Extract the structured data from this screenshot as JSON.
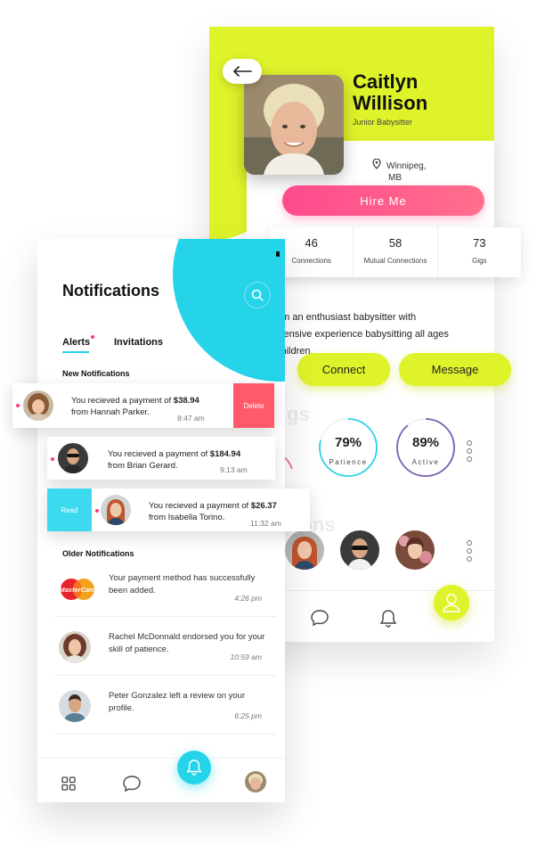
{
  "profile": {
    "back_label": "←",
    "first_name": "Caitlyn",
    "last_name": "Willison",
    "role": "Junior Babysitter",
    "location_line1": "Winnipeg,",
    "location_line2": "MB",
    "hire_label": "Hire Me",
    "stats": [
      {
        "value": "46",
        "label": "Connections"
      },
      {
        "value": "58",
        "label": "Mutual Connections"
      },
      {
        "value": "73",
        "label": "Gigs"
      }
    ],
    "about_title": "o",
    "about_lines": [
      "am an enthusiast babysitter with",
      "xtensive experience babysitting all ages",
      "children."
    ],
    "connect_label": "Connect",
    "message_label": "Message",
    "faded_skills": "gs",
    "faded_connections": "tions",
    "rings": [
      {
        "value": "79%",
        "label": "Patience",
        "fraction": 0.79,
        "color": "#2bd3e8"
      },
      {
        "value": "89%",
        "label": "Active",
        "fraction": 0.89,
        "color": "#7a5fb0"
      }
    ],
    "partial_ring_color": "#ff5a6a",
    "accent_color": "#dff32a"
  },
  "notifications": {
    "title": "Notifications",
    "tabs": [
      "Alerts",
      "Invitations"
    ],
    "new_header": "New Notifications",
    "older_header": "Older Notifications",
    "new_items": [
      {
        "text": "You recieved a payment of",
        "amount": "$38.94",
        "from": "from Hannah Parker.",
        "time": "8:47 am",
        "action": "Delete"
      },
      {
        "text": "You recieved a payment of",
        "amount": "$184.94",
        "from": "from Brian Gerard.",
        "time": "9:13 am"
      },
      {
        "text": "You recieved a payment of",
        "amount": "$26.37",
        "from": "from Isabella Torino.",
        "time": "11:32 am",
        "action": "Read"
      }
    ],
    "older_items": [
      {
        "text": "Your payment method has successfully been added.",
        "time": "4:26 pm",
        "icon": "mastercard-icon"
      },
      {
        "text": "Rachel McDonnald endorsed you for your skill of patience.",
        "time": "10:59 am"
      },
      {
        "text": "Peter Gonzalez left a review on your profile.",
        "time": "6:25 pm"
      }
    ],
    "mastercard_text": "MasterCard",
    "accent_color": "#26d4ea",
    "delete_color": "#ff5a6a"
  }
}
